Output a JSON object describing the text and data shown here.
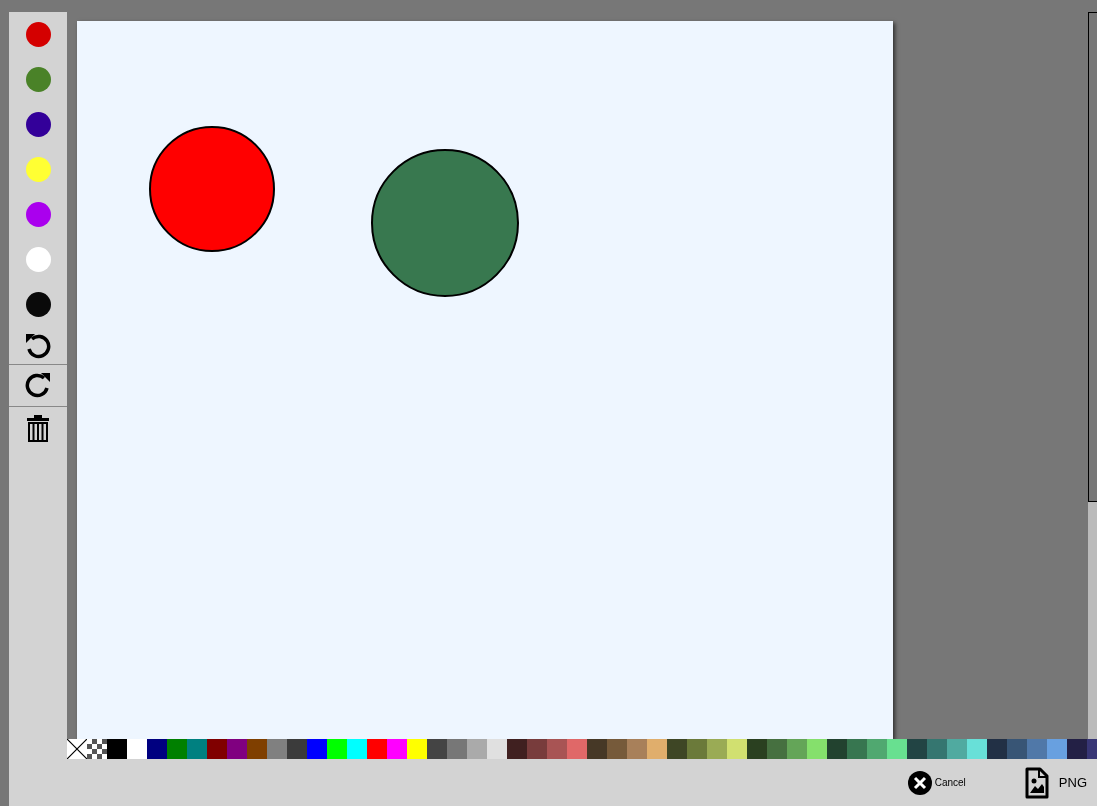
{
  "toolbar": {
    "colors": [
      {
        "color": "#d40000"
      },
      {
        "color": "#4a8228"
      },
      {
        "color": "#330099"
      },
      {
        "color": "#ffff33"
      },
      {
        "color": "#aa00ee"
      },
      {
        "color": "#ffffff"
      },
      {
        "color": "#0a0a0a"
      }
    ]
  },
  "canvas": {
    "shapes": [
      {
        "kind": "circle",
        "color": "#ff0000"
      },
      {
        "kind": "circle",
        "color": "#38784f"
      }
    ]
  },
  "palette": [
    {
      "kind": "none"
    },
    {
      "kind": "transparent"
    },
    {
      "kind": "color",
      "color": "#000000"
    },
    {
      "kind": "color",
      "color": "#ffffff"
    },
    {
      "kind": "color",
      "color": "#000080"
    },
    {
      "kind": "color",
      "color": "#008000"
    },
    {
      "kind": "color",
      "color": "#008080"
    },
    {
      "kind": "color",
      "color": "#800000"
    },
    {
      "kind": "color",
      "color": "#800080"
    },
    {
      "kind": "color",
      "color": "#7f3f00"
    },
    {
      "kind": "color",
      "color": "#808080"
    },
    {
      "kind": "color",
      "color": "#3b3b3b"
    },
    {
      "kind": "color",
      "color": "#0000ff"
    },
    {
      "kind": "color",
      "color": "#00ff00"
    },
    {
      "kind": "color",
      "color": "#00ffff"
    },
    {
      "kind": "color",
      "color": "#ff0000"
    },
    {
      "kind": "color",
      "color": "#ff00ff"
    },
    {
      "kind": "color",
      "color": "#ffff00"
    },
    {
      "kind": "color",
      "color": "#444444"
    },
    {
      "kind": "color",
      "color": "#777777"
    },
    {
      "kind": "color",
      "color": "#aaaaaa"
    },
    {
      "kind": "color",
      "color": "#e0e0e0"
    },
    {
      "kind": "color",
      "color": "#402020"
    },
    {
      "kind": "color",
      "color": "#783c3c"
    },
    {
      "kind": "color",
      "color": "#a85454"
    },
    {
      "kind": "color",
      "color": "#e06868"
    },
    {
      "kind": "color",
      "color": "#463826"
    },
    {
      "kind": "color",
      "color": "#765a3a"
    },
    {
      "kind": "color",
      "color": "#a8805a"
    },
    {
      "kind": "color",
      "color": "#e0ae6c"
    },
    {
      "kind": "color",
      "color": "#3e4625"
    },
    {
      "kind": "color",
      "color": "#6b7a3a"
    },
    {
      "kind": "color",
      "color": "#9aab55"
    },
    {
      "kind": "color",
      "color": "#d1e070"
    },
    {
      "kind": "color",
      "color": "#2a4020"
    },
    {
      "kind": "color",
      "color": "#467040"
    },
    {
      "kind": "color",
      "color": "#64a558"
    },
    {
      "kind": "color",
      "color": "#85e06c"
    },
    {
      "kind": "color",
      "color": "#22422f"
    },
    {
      "kind": "color",
      "color": "#377650"
    },
    {
      "kind": "color",
      "color": "#50a870"
    },
    {
      "kind": "color",
      "color": "#68e090"
    },
    {
      "kind": "color",
      "color": "#224444"
    },
    {
      "kind": "color",
      "color": "#357670"
    },
    {
      "kind": "color",
      "color": "#50aaa0"
    },
    {
      "kind": "color",
      "color": "#68e0d8"
    },
    {
      "kind": "color",
      "color": "#223045"
    },
    {
      "kind": "color",
      "color": "#385575"
    },
    {
      "kind": "color",
      "color": "#5078a8"
    },
    {
      "kind": "color",
      "color": "#68a0e0"
    },
    {
      "kind": "color",
      "color": "#232045"
    },
    {
      "kind": "color",
      "color": "#383675"
    }
  ],
  "buttons": {
    "cancel": "Cancel",
    "export": "PNG"
  }
}
